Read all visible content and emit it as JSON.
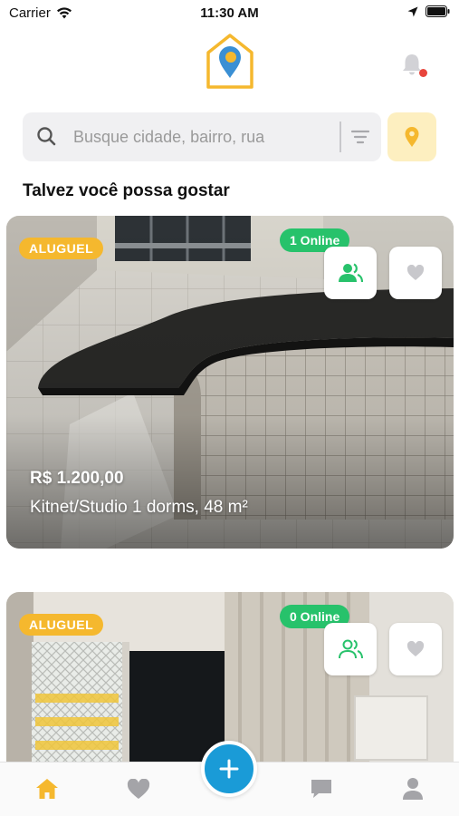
{
  "status_bar": {
    "carrier": "Carrier",
    "time": "11:30 AM"
  },
  "search": {
    "placeholder": "Busque cidade, bairro, rua",
    "value": ""
  },
  "section": {
    "title": "Talvez você possa gostar"
  },
  "listings": [
    {
      "badge": "ALUGUEL",
      "online": "1 Online",
      "price": "R$ 1.200,00",
      "description": "Kitnet/Studio 1 dorms, 48 m²",
      "favorited": false
    },
    {
      "badge": "ALUGUEL",
      "online": "0 Online",
      "favorited": false
    }
  ],
  "tabs": [
    "home-icon",
    "heart-icon",
    "add-icon",
    "chat-icon",
    "profile-icon"
  ],
  "colors": {
    "accent_yellow": "#f5b82e",
    "online_green": "#27c26b",
    "primary_blue": "#1a9bd7",
    "location_bg": "#fdefc0",
    "notification_red": "#e8453c"
  }
}
